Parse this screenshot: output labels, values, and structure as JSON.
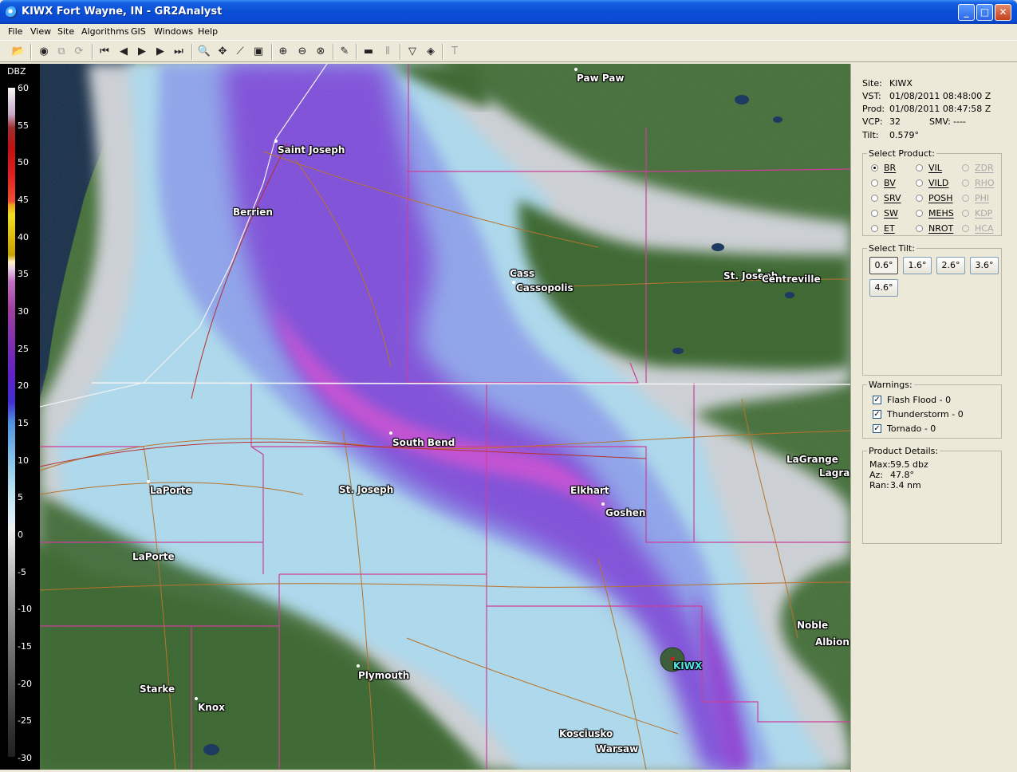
{
  "window": {
    "title": "KIWX Fort Wayne, IN - GR2Analyst"
  },
  "menu": [
    "File",
    "View",
    "Site",
    "Algorithms",
    "GIS",
    "Windows",
    "Help"
  ],
  "toolbar_icons": [
    "open-icon",
    "globe-icon",
    "copy-icon",
    "refresh-icon",
    "first-frame-icon",
    "prev-frame-icon",
    "play-icon",
    "next-frame-icon",
    "last-frame-icon",
    "zoom-icon",
    "pan-icon",
    "measure-icon",
    "layers-icon",
    "zoom-in-icon",
    "zoom-out-icon",
    "zoom-reset-icon",
    "brush-icon",
    "bar-icon",
    "split-icon",
    "filter-icon",
    "diamond-icon",
    "text-icon"
  ],
  "scale": {
    "title": "DBZ",
    "labels": [
      "60",
      "55",
      "50",
      "45",
      "40",
      "35",
      "30",
      "25",
      "20",
      "15",
      "10",
      "5",
      "0",
      "-5",
      "-10",
      "-15",
      "-20",
      "-25",
      "-30"
    ]
  },
  "map": {
    "cities": [
      {
        "name": "Paw Paw"
      },
      {
        "name": "Saint Joseph"
      },
      {
        "name": "Berrien"
      },
      {
        "name": "Cass"
      },
      {
        "name": "Cassopolis"
      },
      {
        "name": "St. Joseph"
      },
      {
        "name": "Centreville"
      },
      {
        "name": "South Bend"
      },
      {
        "name": "LaPorte"
      },
      {
        "name": "St. Joseph"
      },
      {
        "name": "Elkhart"
      },
      {
        "name": "Goshen"
      },
      {
        "name": "LaGrange"
      },
      {
        "name": "Lagra"
      },
      {
        "name": "LaPorte"
      },
      {
        "name": "Noble"
      },
      {
        "name": "Albion"
      },
      {
        "name": "Plymouth"
      },
      {
        "name": "Starke"
      },
      {
        "name": "Knox"
      },
      {
        "name": "Kosciusko"
      },
      {
        "name": "Warsaw"
      }
    ],
    "radar_site": "KIWX"
  },
  "info": {
    "site_label": "Site:",
    "site": "KIWX",
    "vst_label": "VST:",
    "vst": "01/08/2011  08:48:00 Z",
    "prod_label": "Prod:",
    "prod": "01/08/2011  08:47:58 Z",
    "vcp_label": "VCP:",
    "vcp": "32",
    "smv_label": "SMV:",
    "smv": "----",
    "tilt_label": "Tilt:",
    "tilt": "0.579°"
  },
  "select_product": {
    "title": "Select Product:",
    "options": [
      {
        "label": "BR",
        "selected": true,
        "enabled": true
      },
      {
        "label": "VIL",
        "selected": false,
        "enabled": true
      },
      {
        "label": "ZDR",
        "selected": false,
        "enabled": false
      },
      {
        "label": "BV",
        "selected": false,
        "enabled": true
      },
      {
        "label": "VILD",
        "selected": false,
        "enabled": true
      },
      {
        "label": "RHO",
        "selected": false,
        "enabled": false
      },
      {
        "label": "SRV",
        "selected": false,
        "enabled": true
      },
      {
        "label": "POSH",
        "selected": false,
        "enabled": true
      },
      {
        "label": "PHI",
        "selected": false,
        "enabled": false
      },
      {
        "label": "SW",
        "selected": false,
        "enabled": true
      },
      {
        "label": "MEHS",
        "selected": false,
        "enabled": true
      },
      {
        "label": "KDP",
        "selected": false,
        "enabled": false
      },
      {
        "label": "ET",
        "selected": false,
        "enabled": true
      },
      {
        "label": "NROT",
        "selected": false,
        "enabled": true
      },
      {
        "label": "HCA",
        "selected": false,
        "enabled": false
      }
    ]
  },
  "select_tilt": {
    "title": "Select Tilt:",
    "options": [
      {
        "label": "0.6°",
        "selected": true
      },
      {
        "label": "1.6°",
        "selected": false
      },
      {
        "label": "2.6°",
        "selected": false
      },
      {
        "label": "3.6°",
        "selected": false
      },
      {
        "label": "4.6°",
        "selected": false
      }
    ]
  },
  "warnings": {
    "title": "Warnings:",
    "items": [
      {
        "label": "Flash Flood - 0",
        "checked": true
      },
      {
        "label": "Thunderstorm - 0",
        "checked": true
      },
      {
        "label": "Tornado - 0",
        "checked": true
      }
    ]
  },
  "product_details": {
    "title": "Product Details:",
    "max_label": "Max:",
    "max": "59.5 dbz",
    "az_label": "Az:",
    "az": "47.8°",
    "ran_label": "Ran:",
    "ran": "3.4 nm"
  },
  "colors": {
    "titlebar": "#0a4fd6",
    "map_land": "#3f6a34",
    "lake": "#132a44",
    "county_line": "#cc3f9a",
    "road": "#b8742c"
  }
}
